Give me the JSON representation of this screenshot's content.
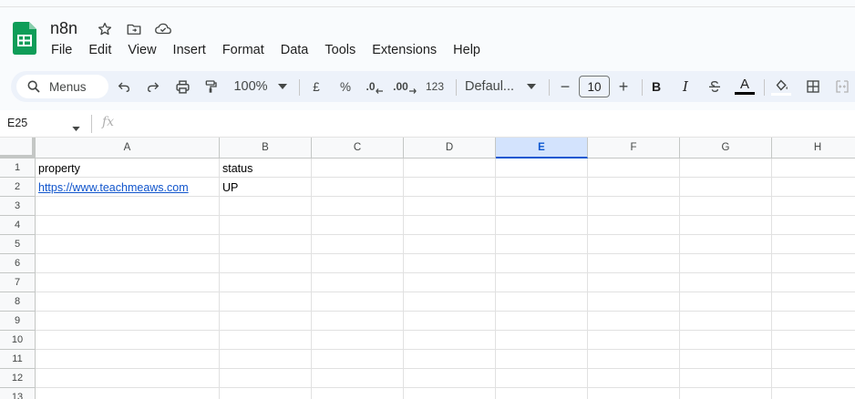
{
  "doc": {
    "title": "n8n"
  },
  "menu": [
    "File",
    "Edit",
    "View",
    "Insert",
    "Format",
    "Data",
    "Tools",
    "Extensions",
    "Help"
  ],
  "toolbar": {
    "menus_label": "Menus",
    "zoom": "100%",
    "currency": "£",
    "percent": "%",
    "dec_decrease": ".0",
    "dec_increase": ".00",
    "number_format": "123",
    "font": "Defaul...",
    "font_size": "10",
    "minus": "−",
    "plus": "+",
    "bold": "B",
    "italic": "I",
    "text_color": "A"
  },
  "formula": {
    "cell_ref": "E25",
    "fx": "fx"
  },
  "columns": [
    "A",
    "B",
    "C",
    "D",
    "E",
    "F",
    "G",
    "H"
  ],
  "selected_column": "E",
  "rows": [
    "1",
    "2",
    "3",
    "4",
    "5",
    "6",
    "7",
    "8",
    "9",
    "10",
    "11",
    "12",
    "13"
  ],
  "cells": {
    "A1": "property",
    "B1": "status",
    "A2": "https://www.teachmeaws.com",
    "B2": "UP"
  },
  "colors": {
    "accent": "#0b57d0",
    "sheets_green": "#0f9d58",
    "link": "#1155cc"
  }
}
